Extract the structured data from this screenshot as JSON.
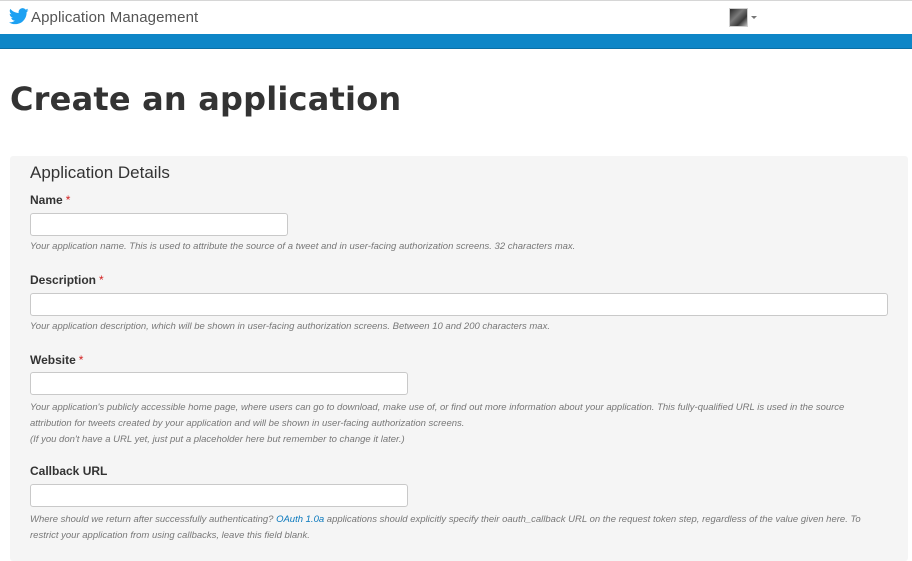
{
  "header": {
    "app_title": "Application Management",
    "logo_icon": "twitter-bird-icon",
    "accent_color": "#0e86c7"
  },
  "page": {
    "title": "Create an application"
  },
  "form": {
    "section_title": "Application Details",
    "required_marker": "*",
    "name": {
      "label": "Name",
      "value": "",
      "help": "Your application name. This is used to attribute the source of a tweet and in user-facing authorization screens. 32 characters max."
    },
    "description": {
      "label": "Description",
      "value": "",
      "help": "Your application description, which will be shown in user-facing authorization screens. Between 10 and 200 characters max."
    },
    "website": {
      "label": "Website",
      "value": "",
      "help_line1": "Your application's publicly accessible home page, where users can go to download, make use of, or find out more information about your application. This fully-qualified URL is used in the source attribution for tweets created by your application and will be shown in user-facing authorization screens.",
      "help_line2": "(If you don't have a URL yet, just put a placeholder here but remember to change it later.)"
    },
    "callback": {
      "label": "Callback URL",
      "value": "",
      "help_before": "Where should we return after successfully authenticating? ",
      "help_link": "OAuth 1.0a",
      "help_after": " applications should explicitly specify their oauth_callback URL on the request token step, regardless of the value given here. To restrict your application from using callbacks, leave this field blank."
    }
  }
}
